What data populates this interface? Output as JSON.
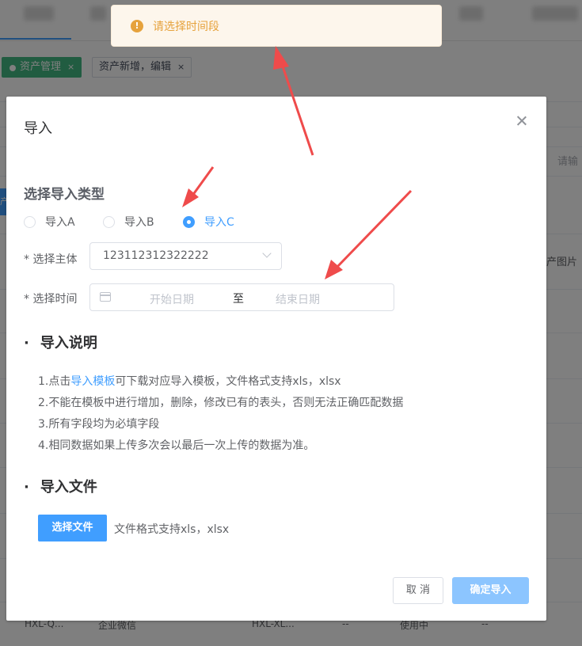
{
  "toast": {
    "text": "请选择时间段"
  },
  "background": {
    "tabs": [
      {
        "label": "资产管理",
        "close": "×"
      },
      {
        "label": "资产新增，编辑",
        "close": "×"
      }
    ],
    "side_texts": [
      "请输",
      "产图片"
    ],
    "left_cut_text": "产",
    "bottom_row": [
      "HXL-Q...",
      "企业微信",
      "HXL-XL...",
      "--",
      "使用中",
      "--"
    ]
  },
  "dialog": {
    "title": "导入",
    "type_section": "选择导入类型",
    "radios": [
      {
        "label": "导入A",
        "checked": false
      },
      {
        "label": "导入B",
        "checked": false
      },
      {
        "label": "导入C",
        "checked": true
      }
    ],
    "subject_label": "* 选择主体",
    "subject_value": "123112312322222",
    "time_label": "* 选择时间",
    "date_start_placeholder": "开始日期",
    "date_separator": "至",
    "date_end_placeholder": "结束日期",
    "instructions_title": "导入说明",
    "instructions": {
      "line1_prefix": "1.点击",
      "line1_link": "导入模板",
      "line1_suffix": "可下载对应导入模板，文件格式支持xls，xlsx",
      "line2": "2.不能在模板中进行增加，删除，修改已有的表头，否则无法正确匹配数据",
      "line3": "3.所有字段均为必填字段",
      "line4": "4.相同数据如果上传多次会以最后一次上传的数据为准。"
    },
    "file_section": "导入文件",
    "choose_file_button": "选择文件",
    "file_hint": "文件格式支持xls，xlsx",
    "cancel_button": "取 消",
    "confirm_button": "确定导入"
  },
  "colors": {
    "primary": "#409eff",
    "warning": "#e6a23c",
    "annotation_arrow": "#ef4b4b"
  }
}
